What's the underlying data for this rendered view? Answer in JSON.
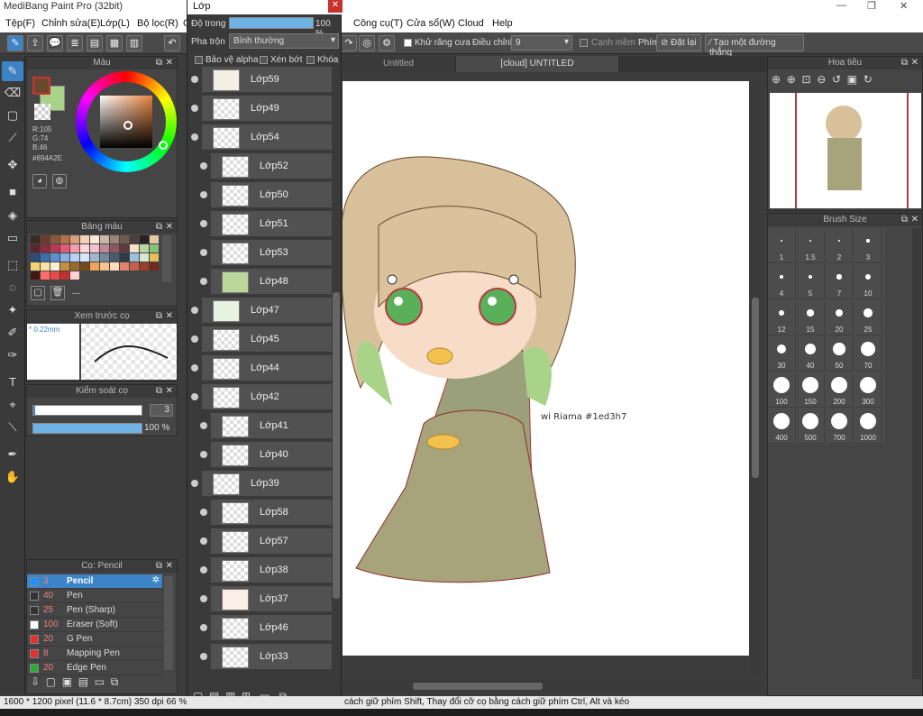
{
  "app": {
    "title": "MediBang Paint Pro (32bit)",
    "minimize": "—",
    "maximize": "❐",
    "close": "✕"
  },
  "menu": [
    "Tệp(F)",
    "Chỉnh sửa(E)",
    "Lớp(L)",
    "Bộ lọc(R)",
    "C",
    "Công cụ(T)",
    "Cửa sổ(W)",
    "Cloud",
    "Help"
  ],
  "toolbar": {
    "antialias": "Khử răng cưa",
    "adjust_label": "Điều chỉnh",
    "adjust_value": "9",
    "soft_edge": "Cạnh mềm",
    "keys_label": "Phím",
    "reset": "Đặt lại",
    "straight": "Tạo một đường thẳng"
  },
  "layer_panel": {
    "title": "Lớp",
    "opacity_label": "Độ trong",
    "opacity_value": "100 %",
    "opacity_fraction": 1.0,
    "blend_label": "Pha trộn",
    "blend_value": "Bình thường",
    "protect_alpha": "Bảo vệ alpha",
    "clip": "Xén bớt",
    "lock": "Khóa",
    "layers": [
      {
        "name": "Lớp59",
        "indent": false,
        "thumb": "#f3efe4"
      },
      {
        "name": "Lớp49",
        "indent": false,
        "thumb": "#ffffff"
      },
      {
        "name": "Lớp54",
        "indent": false,
        "thumb": "#ffffff"
      },
      {
        "name": "Lớp52",
        "indent": true,
        "thumb": "#ffffff"
      },
      {
        "name": "Lớp50",
        "indent": true,
        "thumb": "#ffffff"
      },
      {
        "name": "Lớp51",
        "indent": true,
        "thumb": "#ffffff"
      },
      {
        "name": "Lớp53",
        "indent": true,
        "thumb": "#ffffff"
      },
      {
        "name": "Lớp48",
        "indent": true,
        "thumb": "#bcd79a"
      },
      {
        "name": "Lớp47",
        "indent": false,
        "thumb": "#e8f2e0"
      },
      {
        "name": "Lớp45",
        "indent": false,
        "thumb": "#ffffff"
      },
      {
        "name": "Lớp44",
        "indent": false,
        "thumb": "#ffffff"
      },
      {
        "name": "Lớp42",
        "indent": false,
        "thumb": "#ffffff"
      },
      {
        "name": "Lớp41",
        "indent": true,
        "thumb": "#ffffff"
      },
      {
        "name": "Lớp40",
        "indent": true,
        "thumb": "#ffffff"
      },
      {
        "name": "Lớp39",
        "indent": false,
        "thumb": "#ffffff"
      },
      {
        "name": "Lớp58",
        "indent": true,
        "thumb": "#ffffff"
      },
      {
        "name": "Lớp57",
        "indent": true,
        "thumb": "#ffffff"
      },
      {
        "name": "Lớp38",
        "indent": true,
        "thumb": "#ffffff"
      },
      {
        "name": "Lớp37",
        "indent": true,
        "thumb": "#fbeee6"
      },
      {
        "name": "Lớp46",
        "indent": true,
        "thumb": "#ffffff"
      },
      {
        "name": "Lớp33",
        "indent": true,
        "thumb": "#ffffff"
      }
    ]
  },
  "color_panel": {
    "title": "Màu",
    "rgb": [
      "R:105",
      "G:74",
      "B:46"
    ],
    "hex": "#694A2E",
    "main_color": "#694A2E",
    "sub_color": "#a9d388"
  },
  "palette_panel": {
    "title": "Bảng màu",
    "more": "---",
    "colors": [
      "#3b2c23",
      "#6b3b2f",
      "#8c5a3b",
      "#b4724a",
      "#d9a07a",
      "#f5d1b5",
      "#fbe8d6",
      "#c9b7ab",
      "#9c8576",
      "#6f5c50",
      "#4b4040",
      "#2b2121",
      "#e2c9a6",
      "#5a2431",
      "#8a2f41",
      "#b53b55",
      "#e25a75",
      "#f59db0",
      "#fcd4dc",
      "#f0c2cf",
      "#c28895",
      "#8d5863",
      "#5d3a42",
      "#f6e3c7",
      "#b9d7a4",
      "#86c07b",
      "#2a4d7a",
      "#3f6ea8",
      "#5b8fd1",
      "#86b0e6",
      "#b8d2f2",
      "#d8e7f8",
      "#a4b7c8",
      "#72889c",
      "#495c6d",
      "#2e3a45",
      "#99c2e0",
      "#d6e8cf",
      "#e6bf5c",
      "#f2d277",
      "#f7e3a6",
      "#fbf0cf",
      "#c48f3e",
      "#9a6a2a",
      "#6e4a1d",
      "#f4a35d",
      "#f7c28f",
      "#fbdcbd",
      "#e0856c",
      "#c5614a",
      "#9b3f2c",
      "#6f2b1e",
      "#421912",
      "#ff6b6b",
      "#e84a4a",
      "#c43030",
      "#ffd1d1"
    ]
  },
  "preview_panel": {
    "title": "Xem trước cọ",
    "size": "* 0.22mm"
  },
  "brush_control": {
    "title": "Kiểm soát cọ",
    "size_value": "3",
    "opacity_value": "100 %",
    "opacity_fraction": 1.0
  },
  "brush_list": {
    "title": "Cọ: Pencil",
    "items": [
      {
        "size": "3",
        "name": "Pencil",
        "color": "#1e90ff",
        "selected": true
      },
      {
        "size": "40",
        "name": "Pen",
        "color": "#333333",
        "selected": false
      },
      {
        "size": "25",
        "name": "Pen (Sharp)",
        "color": "#333333",
        "selected": false
      },
      {
        "size": "100",
        "name": "Eraser (Soft)",
        "color": "#ffffff",
        "selected": false
      },
      {
        "size": "20",
        "name": "G Pen",
        "color": "#e03030",
        "selected": false
      },
      {
        "size": "8",
        "name": "Mapping Pen",
        "color": "#e03030",
        "selected": false
      },
      {
        "size": "20",
        "name": "Edge Pen",
        "color": "#2ea83a",
        "selected": false
      }
    ]
  },
  "tabs": [
    "Untitled",
    "[cloud] UNTITLED"
  ],
  "navigator": {
    "title": "Hoa tiêu"
  },
  "brush_size": {
    "title": "Brush Size",
    "sizes": [
      "1",
      "1.5",
      "2",
      "3",
      "4",
      "5",
      "7",
      "10",
      "12",
      "15",
      "20",
      "25",
      "30",
      "40",
      "50",
      "70",
      "100",
      "150",
      "200",
      "300",
      "400",
      "500",
      "700",
      "1000"
    ]
  },
  "status": {
    "info": "1600 * 1200 pixel  (11.6 * 8.7cm)  350 dpi  66 %",
    "hint": "cách giữ phím Shift, Thay đổi cỡ cọ bằng cách giữ phím Ctrl, Alt và kéo"
  },
  "canvas_signature": "wi Riama  #1ed3h7"
}
